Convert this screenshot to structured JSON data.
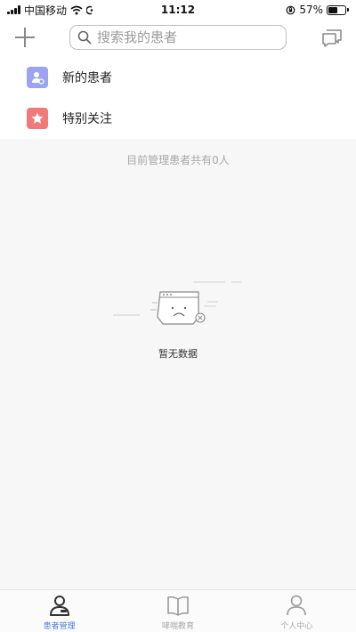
{
  "status_bar": {
    "carrier": "中国移动",
    "time": "11:12",
    "battery": "57%",
    "battery_level": 0.57
  },
  "header": {
    "search_placeholder": "搜索我的患者"
  },
  "menu": {
    "items": [
      {
        "label": "新的患者",
        "icon": "new-patient-icon",
        "color": "#9aa4f2"
      },
      {
        "label": "特别关注",
        "icon": "star-icon",
        "color": "#f07a7a"
      }
    ]
  },
  "content": {
    "count_text": "目前管理患者共有0人",
    "empty_text": "暂无数据"
  },
  "tabs": [
    {
      "label": "患者管理",
      "icon": "patient-manage-icon",
      "active": true
    },
    {
      "label": "哮喘教育",
      "icon": "book-icon",
      "active": false
    },
    {
      "label": "个人中心",
      "icon": "person-icon",
      "active": false
    }
  ],
  "colors": {
    "accent": "#4a7cdc",
    "content_bg": "#f7f7f7"
  }
}
